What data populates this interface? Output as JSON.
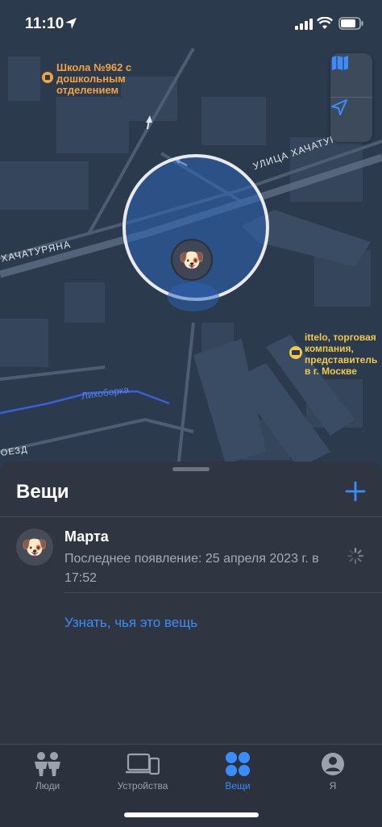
{
  "status_bar": {
    "time": "11:10"
  },
  "map": {
    "labels": {
      "school": "Школа №962 с дошкольным отделением",
      "street_a": "УЛИЦА ХАЧАТУРЯ",
      "street_b": "ХАЧАТУРЯНА",
      "river": "Лихоборка",
      "passage": "ОЕЗД",
      "company": "ittelo, торговая компания, представитель в г. Москве"
    },
    "controls": {
      "map_mode_icon": "map-icon",
      "locate_icon": "location-arrow-icon"
    },
    "pin_emoji": "🐶"
  },
  "sheet": {
    "title": "Вещи",
    "add_icon": "plus-icon",
    "item": {
      "name": "Марта",
      "status": "Последнее появление: 25 апреля 2023 г. в 17:52",
      "emoji": "🐶"
    },
    "identify_link": "Узнать, чья это вещь"
  },
  "tabs": [
    {
      "label": "Люди",
      "icon": "people-icon",
      "active": false
    },
    {
      "label": "Устройства",
      "icon": "devices-icon",
      "active": false
    },
    {
      "label": "Вещи",
      "icon": "items-icon",
      "active": true
    },
    {
      "label": "Я",
      "icon": "person-icon",
      "active": false
    }
  ],
  "colors": {
    "accent": "#3a8cff",
    "map_label_orange": "#f2a341",
    "river_blue": "#3a5fd6"
  }
}
